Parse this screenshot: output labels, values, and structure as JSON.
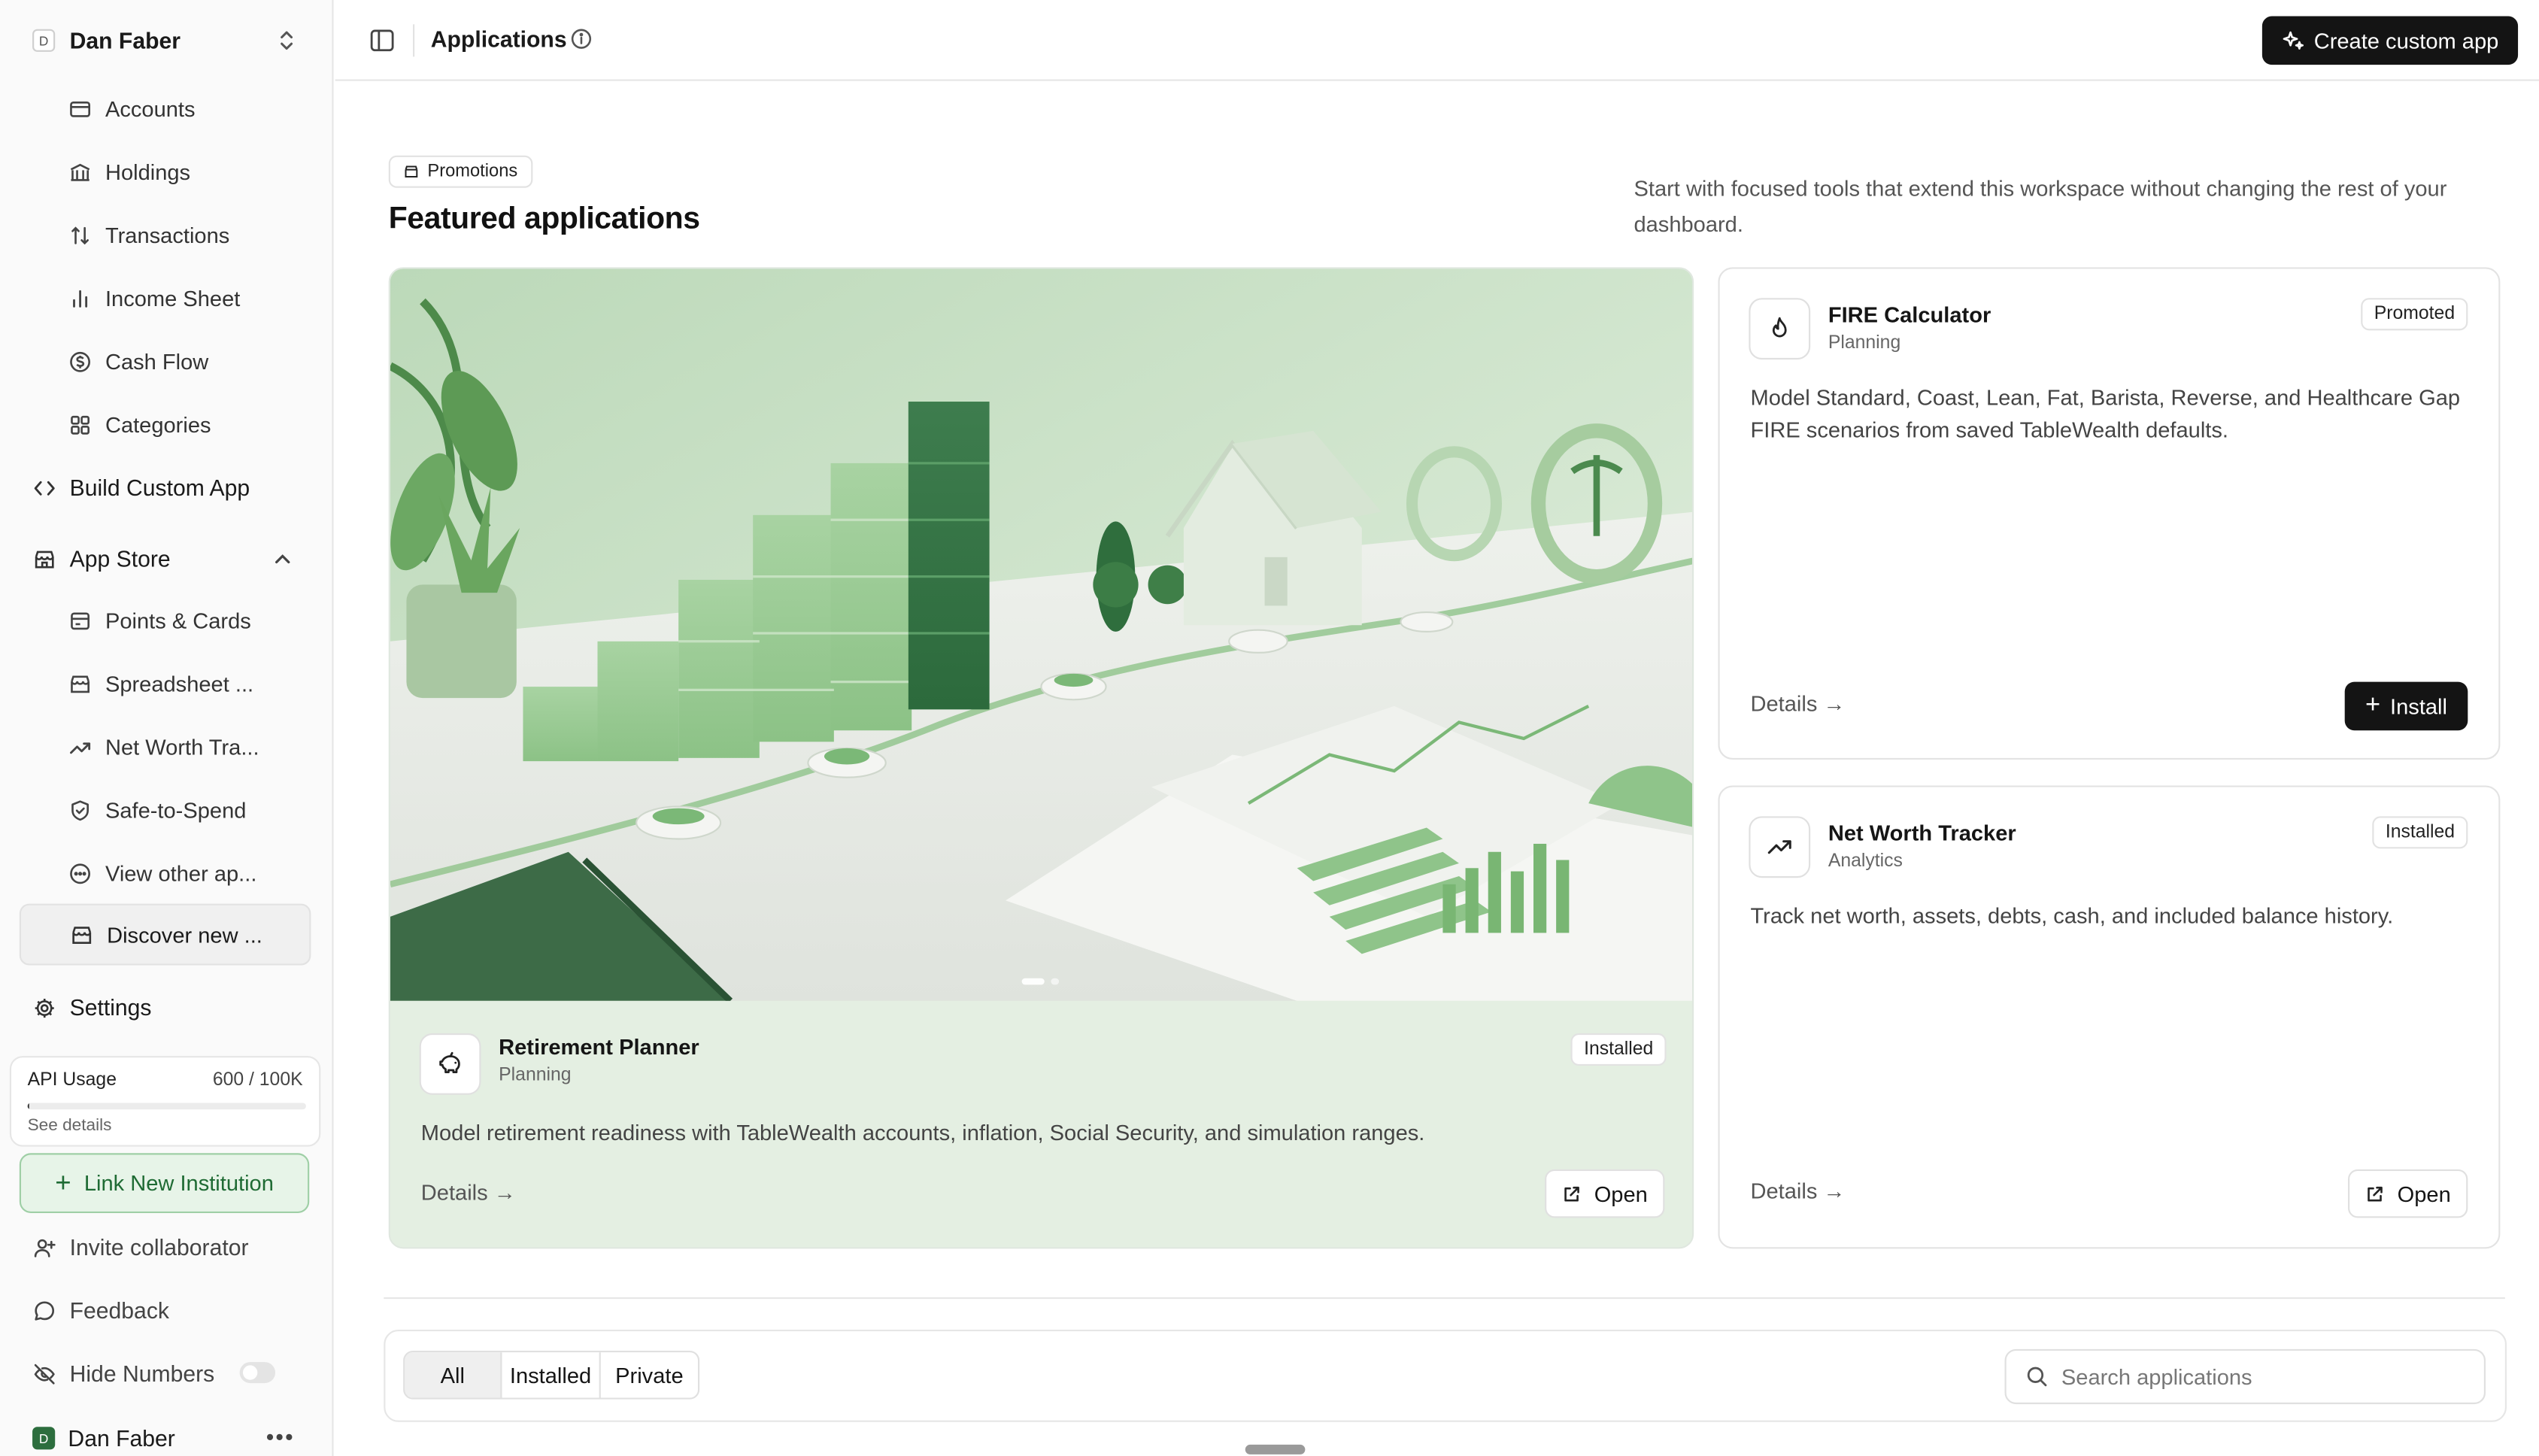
{
  "workspace": {
    "initial": "D",
    "name": "Dan Faber"
  },
  "sidebar": {
    "finance_items": [
      {
        "label": "Accounts",
        "icon": "credit-card-icon"
      },
      {
        "label": "Holdings",
        "icon": "bank-icon"
      },
      {
        "label": "Transactions",
        "icon": "arrows-up-down-icon"
      },
      {
        "label": "Income Sheet",
        "icon": "bar-chart-icon"
      },
      {
        "label": "Cash Flow",
        "icon": "dollar-circle-icon"
      },
      {
        "label": "Categories",
        "icon": "grid-icon"
      }
    ],
    "build_custom_app": "Build Custom App",
    "app_store": {
      "label": "App Store",
      "items": [
        {
          "label": "Points & Cards",
          "icon": "wallet-icon"
        },
        {
          "label": "Spreadsheet ...",
          "icon": "store-icon"
        },
        {
          "label": "Net Worth Tra...",
          "icon": "trend-up-icon"
        },
        {
          "label": "Safe-to-Spend",
          "icon": "shield-check-icon"
        },
        {
          "label": "View other ap...",
          "icon": "more-circle-icon"
        },
        {
          "label": "Discover new ...",
          "icon": "store-icon"
        }
      ]
    },
    "settings": "Settings",
    "api_usage": {
      "title": "API Usage",
      "count": "600 / 100K",
      "fill_fraction": 0.006,
      "link": "See details"
    },
    "link_institution": "Link New Institution",
    "invite": "Invite collaborator",
    "feedback": "Feedback",
    "hide_numbers": {
      "label": "Hide Numbers",
      "on": false
    },
    "user": {
      "initial": "D",
      "name": "Dan Faber"
    }
  },
  "header": {
    "title": "Applications",
    "create_button": "Create custom app"
  },
  "featured": {
    "chip": "Promotions",
    "title": "Featured applications",
    "description": "Start with focused tools that extend this workspace without changing the rest of your dashboard.",
    "hero": {
      "name": "Retirement Planner",
      "category": "Planning",
      "status": "Installed",
      "description": "Model retirement readiness with TableWealth accounts, inflation, Social Security, and simulation ranges.",
      "details": "Details →",
      "action": "Open"
    },
    "cards": [
      {
        "name": "FIRE Calculator",
        "category": "Planning",
        "status": "Promoted",
        "description": "Model Standard, Coast, Lean, Fat, Barista, Reverse, and Healthcare Gap FIRE scenarios from saved TableWealth defaults.",
        "details": "Details →",
        "action": "Install"
      },
      {
        "name": "Net Worth Tracker",
        "category": "Analytics",
        "status": "Installed",
        "description": "Track net worth, assets, debts, cash, and included balance history.",
        "details": "Details →",
        "action": "Open"
      }
    ]
  },
  "filters": {
    "tabs": [
      "All",
      "Installed",
      "Private"
    ],
    "active": "All",
    "search_placeholder": "Search applications"
  },
  "colors": {
    "accent_green": "#2d6e3e",
    "dark_button": "#141414",
    "hero_tint": "#e4efe2"
  }
}
